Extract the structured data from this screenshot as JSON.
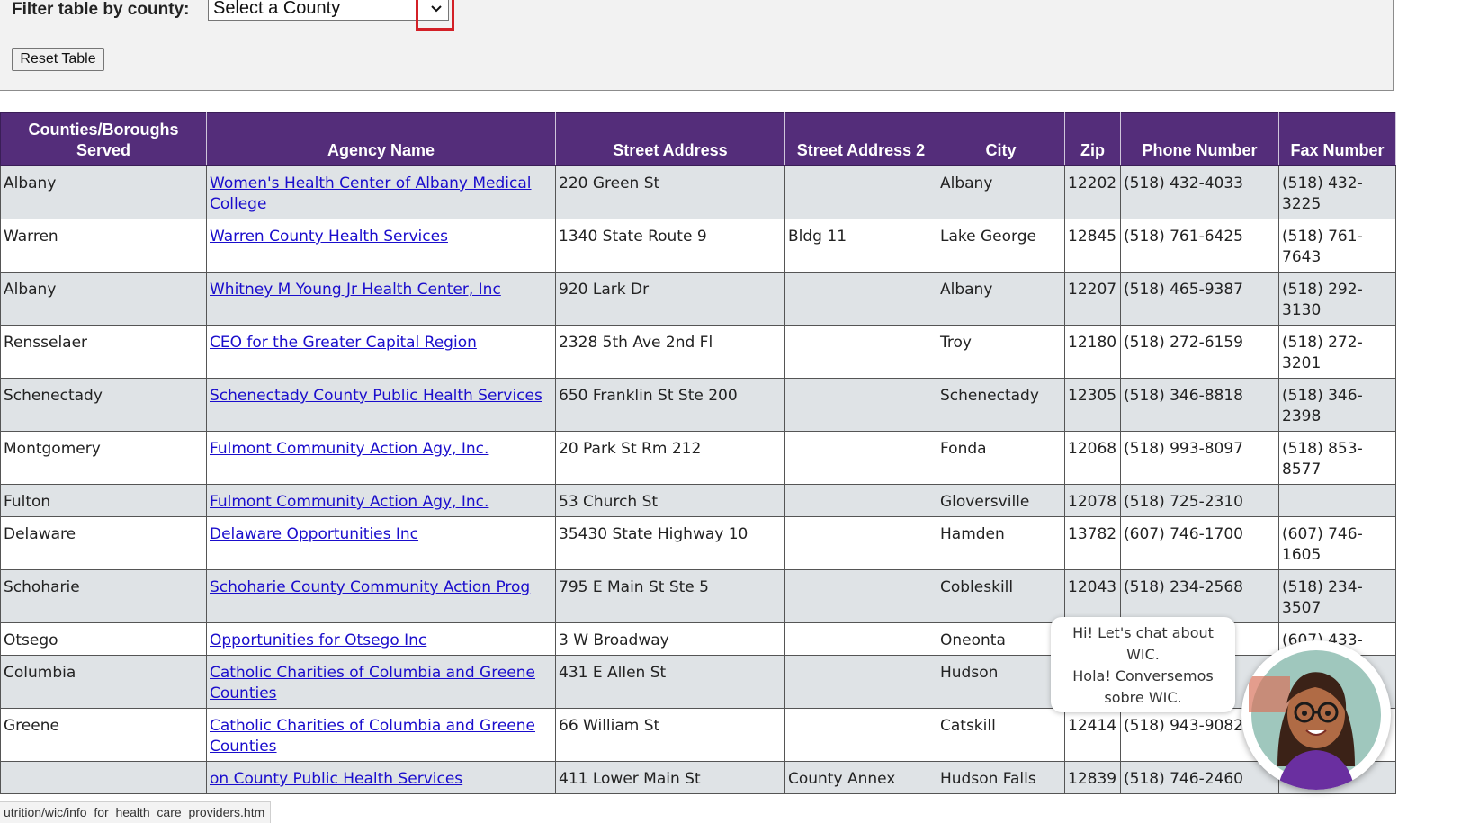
{
  "filter": {
    "label": "Filter table by county:",
    "select_value": "Select a County",
    "reset_label": "Reset Table"
  },
  "table": {
    "headers": [
      "Counties/Boroughs Served",
      "Agency Name",
      "Street Address",
      "Street Address 2",
      "City",
      "Zip",
      "Phone Number",
      "Fax Number"
    ],
    "rows": [
      {
        "county": "Albany",
        "agency": "Women's Health Center of Albany Medical College",
        "street": "220 Green St",
        "street2": "",
        "city": "Albany",
        "zip": "12202",
        "phone": "(518) 432-4033",
        "fax": "(518) 432-3225"
      },
      {
        "county": "Warren",
        "agency": "Warren County Health Services",
        "street": "1340 State Route 9",
        "street2": "Bldg 11",
        "city": "Lake George",
        "zip": "12845",
        "phone": "(518) 761-6425",
        "fax": "(518) 761-7643"
      },
      {
        "county": "Albany",
        "agency": "Whitney M Young Jr Health Center, Inc",
        "street": "920 Lark Dr",
        "street2": "",
        "city": "Albany",
        "zip": "12207",
        "phone": "(518) 465-9387",
        "fax": "(518) 292-3130"
      },
      {
        "county": "Rensselaer",
        "agency": "CEO for the Greater Capital Region",
        "street": "2328 5th Ave 2nd Fl",
        "street2": "",
        "city": "Troy",
        "zip": "12180",
        "phone": "(518) 272-6159",
        "fax": "(518) 272-3201"
      },
      {
        "county": "Schenectady",
        "agency": "Schenectady County Public Health Services",
        "street": "650 Franklin St Ste 200",
        "street2": "",
        "city": "Schenectady",
        "zip": "12305",
        "phone": "(518) 346-8818",
        "fax": "(518) 346-2398"
      },
      {
        "county": "Montgomery",
        "agency": "Fulmont Community Action Agy, Inc.",
        "street": "20 Park St Rm 212",
        "street2": "",
        "city": "Fonda",
        "zip": "12068",
        "phone": "(518) 993-8097",
        "fax": "(518) 853-8577"
      },
      {
        "county": "Fulton",
        "agency": "Fulmont Community Action Agy, Inc.",
        "street": "53 Church St",
        "street2": "",
        "city": "Gloversville",
        "zip": "12078",
        "phone": "(518) 725-2310",
        "fax": ""
      },
      {
        "county": "Delaware",
        "agency": "Delaware Opportunities Inc",
        "street": "35430 State Highway 10",
        "street2": "",
        "city": "Hamden",
        "zip": "13782",
        "phone": "(607) 746-1700",
        "fax": "(607) 746-1605"
      },
      {
        "county": "Schoharie",
        "agency": "Schoharie County Community Action Prog",
        "street": "795 E Main St Ste 5",
        "street2": "",
        "city": "Cobleskill",
        "zip": "12043",
        "phone": "(518) 234-2568",
        "fax": "(518) 234-3507"
      },
      {
        "county": "Otsego",
        "agency": "Opportunities for Otsego Inc",
        "street": "3 W Broadway",
        "street2": "",
        "city": "Oneonta",
        "zip": "",
        "phone": "",
        "fax": "(607) 433-"
      },
      {
        "county": "Columbia",
        "agency": "Catholic Charities of Columbia and Greene Counties",
        "street": "431 E Allen St",
        "street2": "",
        "city": "Hudson",
        "zip": "",
        "phone": "",
        "fax": ""
      },
      {
        "county": "Greene",
        "agency": "Catholic Charities of Columbia and Greene Counties",
        "street": "66 William St",
        "street2": "",
        "city": "Catskill",
        "zip": "12414",
        "phone": "(518) 943-9082",
        "fax": ""
      },
      {
        "county": "",
        "agency": "on County Public Health Services",
        "street": "411 Lower Main St",
        "street2": "County Annex",
        "city": "Hudson Falls",
        "zip": "12839",
        "phone": "(518) 746-2460",
        "fax": ""
      }
    ]
  },
  "status_bar": {
    "url": "utrition/wic/info_for_health_care_providers.htm"
  },
  "chat": {
    "line1": "Hi! Let's chat about",
    "line2": "WIC.",
    "line3": "Hola! Conversemos",
    "line4": "sobre WIC."
  },
  "colors": {
    "header_bg": "#542d7a",
    "row_alt_bg": "#dfe3e6",
    "link": "#1a0dcc",
    "focus_outline": "#d32027"
  }
}
